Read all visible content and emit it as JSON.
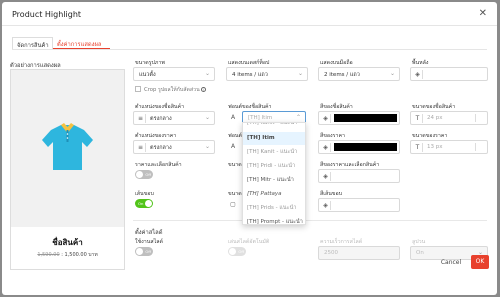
{
  "modal": {
    "title": "Product Highlight",
    "close": "✕"
  },
  "tabs": [
    {
      "label": "จัดการสินค้า"
    },
    {
      "label": "ตั้งค่าการแสดงผล"
    }
  ],
  "preview": {
    "label": "ตัวอย่างการแสดงผล",
    "product_name": "ชื่อสินค้า",
    "old_price": "1,590.00",
    "new_price": "1,500.00 บาท",
    "shirt_color": "#2eb6de",
    "collar_color": "#f5c242"
  },
  "row1": [
    {
      "label": "ขนาดรูปภาพ",
      "value": "แนวตั้ง"
    },
    {
      "label": "แสดงบนเดสก์ท็อป",
      "value": "4 items / แถว"
    },
    {
      "label": "แสดงบนมือถือ",
      "value": "2 items / แถว"
    },
    {
      "label": "พื้นหลัง"
    }
  ],
  "crop_label": "Crop รูปผลให้กับสัดส่วน",
  "info_icon": "i",
  "row2": [
    {
      "label": "ตำแหน่งของชื่อสินค้า",
      "value": "ตรงกลาง"
    },
    {
      "label": "ฟอนต์ของชื่อสินค้า",
      "value": "[TH] Itim"
    },
    {
      "label": "สีของชื่อสินค้า"
    },
    {
      "label": "ขนาดของชื่อสินค้า",
      "value": "24 px"
    }
  ],
  "row3": [
    {
      "label": "ตำแหน่งของราคา",
      "value": "ตรงกลาง"
    },
    {
      "label": "ฟอนต์"
    },
    {
      "label": "สีของราคา"
    },
    {
      "label": "ขนาดของราคา",
      "value": "13 px"
    }
  ],
  "row4": [
    {
      "label": "ราคาและเลือกสินค้า",
      "toggle": "Off"
    },
    {
      "label": "ขนาด"
    },
    {
      "label": "สีของราคาและเลือกสินค้า"
    }
  ],
  "row5": [
    {
      "label": "เส้นขอบ",
      "toggle": "On"
    },
    {
      "label": "ขนาด"
    },
    {
      "label": "สีเส้นขอบ"
    }
  ],
  "slide": {
    "title": "ตั้งค่าสไลด์",
    "use_slide": {
      "label": "ใช้งานสไลด์",
      "toggle": "Off"
    },
    "auto_slide": {
      "label": "เล่นสไลด์อัตโนมัติ",
      "toggle": "Off"
    },
    "speed": {
      "label": "ความเร็วการสไลด์",
      "value": "2500"
    },
    "loop": {
      "label": "ลูปวน",
      "value": "On"
    }
  },
  "font_dropdown": [
    {
      "label": "[TH] Itim"
    },
    {
      "label": "[TH] Kanit - แนะนำ"
    },
    {
      "label": "[TH] Pridi - แนะนำ"
    },
    {
      "label": "[TH] Mitr - แนะนำ"
    },
    {
      "label": "[TH] Pattaya"
    },
    {
      "label": "[TH] Prids - แนะนำ"
    },
    {
      "label": "[TH] Prompt - แนะนำ"
    }
  ],
  "footer": {
    "cancel": "Cancel",
    "ok": "OK"
  },
  "colors": {
    "accent": "#e8412d",
    "toggle_on": "#52c41a",
    "black_swatch": "#000000"
  }
}
